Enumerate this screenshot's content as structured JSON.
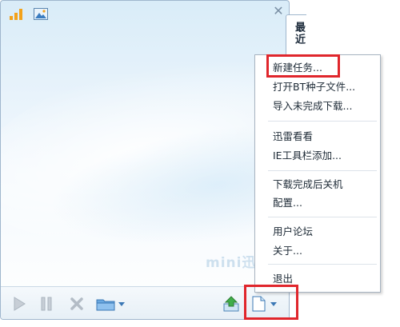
{
  "window": {
    "side_tab_label": "最近",
    "watermark": "mini迅",
    "icons": {
      "signal": "signal-bars-icon",
      "picture": "picture-icon",
      "close": "close-icon"
    }
  },
  "toolbar": {
    "buttons": [
      {
        "name": "play-button",
        "icon": "play-icon"
      },
      {
        "name": "pause-button",
        "icon": "pause-icon"
      },
      {
        "name": "delete-button",
        "icon": "close-x-icon"
      },
      {
        "name": "open-folder-button",
        "icon": "folder-icon"
      },
      {
        "name": "upload-button",
        "icon": "upload-icon"
      },
      {
        "name": "new-task-menu-button",
        "icon": "document-icon"
      }
    ]
  },
  "menu": {
    "items": [
      {
        "label": "新建任务..."
      },
      {
        "label": "打开BT种子文件..."
      },
      {
        "label": "导入未完成下载..."
      },
      {
        "label": "迅雷看看"
      },
      {
        "label": "IE工具栏添加..."
      },
      {
        "label": "下载完成后关机"
      },
      {
        "label": "配置..."
      },
      {
        "label": "用户论坛"
      },
      {
        "label": "关于..."
      },
      {
        "label": "退出"
      }
    ]
  },
  "colors": {
    "highlight_box": "#e0262c",
    "accent_blue": "#2f8fd8",
    "accent_orange": "#f3a21b"
  }
}
